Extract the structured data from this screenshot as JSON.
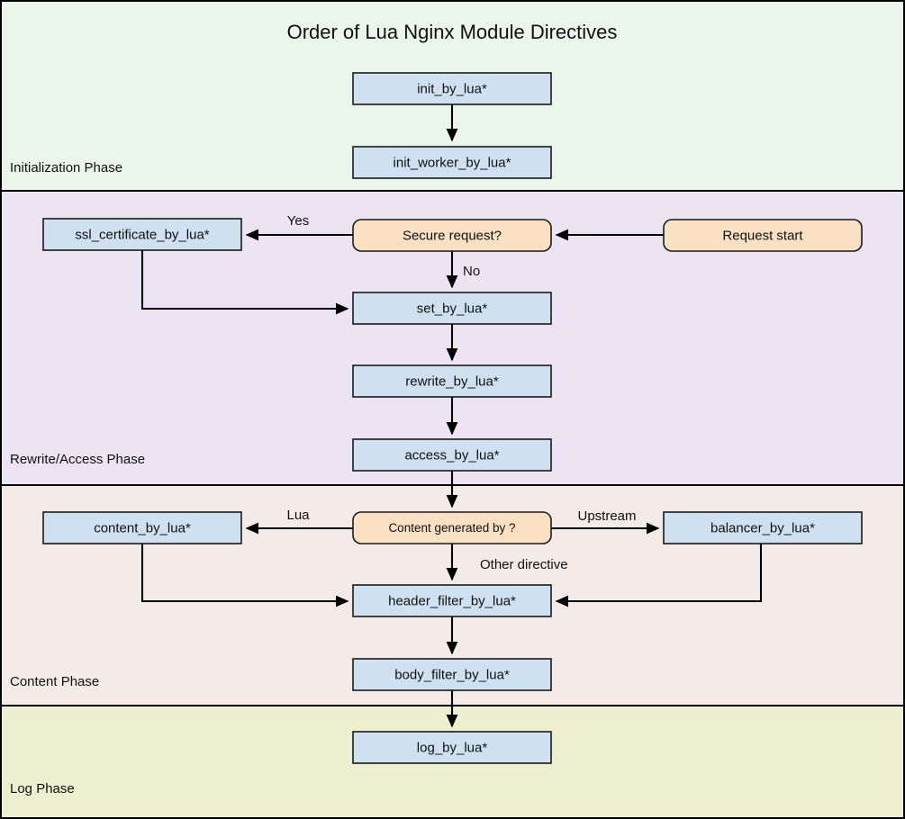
{
  "title": "Order of Lua Nginx Module Directives",
  "colors": {
    "process_fill": "#cfe0f0",
    "decision_fill": "#fae0c3",
    "band_init": "#eaf5ec",
    "band_rewrite": "#ece4f3",
    "band_content": "#f4eae8",
    "band_log": "#eeeed0",
    "stroke": "#000000",
    "text": "#111111"
  },
  "bands": [
    {
      "id": "initialization",
      "label": "Initialization Phase",
      "fill": "#eaf5ec"
    },
    {
      "id": "rewrite_access",
      "label": "Rewrite/Access Phase",
      "fill": "#ece4f3"
    },
    {
      "id": "content",
      "label": "Content Phase",
      "fill": "#f4eae8"
    },
    {
      "id": "log",
      "label": "Log Phase",
      "fill": "#eeeed0"
    }
  ],
  "nodes": [
    {
      "id": "init_by_lua",
      "label": "init_by_lua*",
      "shape": "process",
      "phase": "initialization"
    },
    {
      "id": "init_worker_by_lua",
      "label": "init_worker_by_lua*",
      "shape": "process",
      "phase": "initialization"
    },
    {
      "id": "request_start",
      "label": "Request start",
      "shape": "decision",
      "phase": "rewrite_access"
    },
    {
      "id": "secure_request",
      "label": "Secure request?",
      "shape": "decision",
      "phase": "rewrite_access"
    },
    {
      "id": "ssl_certificate_by_lua",
      "label": "ssl_certificate_by_lua*",
      "shape": "process",
      "phase": "rewrite_access"
    },
    {
      "id": "set_by_lua",
      "label": "set_by_lua*",
      "shape": "process",
      "phase": "rewrite_access"
    },
    {
      "id": "rewrite_by_lua",
      "label": "rewrite_by_lua*",
      "shape": "process",
      "phase": "rewrite_access"
    },
    {
      "id": "access_by_lua",
      "label": "access_by_lua*",
      "shape": "process",
      "phase": "rewrite_access"
    },
    {
      "id": "content_generated_by",
      "label": "Content generated by ?",
      "shape": "decision",
      "phase": "content"
    },
    {
      "id": "content_by_lua",
      "label": "content_by_lua*",
      "shape": "process",
      "phase": "content"
    },
    {
      "id": "balancer_by_lua",
      "label": "balancer_by_lua*",
      "shape": "process",
      "phase": "content"
    },
    {
      "id": "header_filter_by_lua",
      "label": "header_filter_by_lua*",
      "shape": "process",
      "phase": "content"
    },
    {
      "id": "body_filter_by_lua",
      "label": "body_filter_by_lua*",
      "shape": "process",
      "phase": "content"
    },
    {
      "id": "log_by_lua",
      "label": "log_by_lua*",
      "shape": "process",
      "phase": "log"
    }
  ],
  "edge_labels": {
    "secure_yes": "Yes",
    "secure_no": "No",
    "content_lua": "Lua",
    "content_upstream": "Upstream",
    "content_other": "Other directive"
  }
}
